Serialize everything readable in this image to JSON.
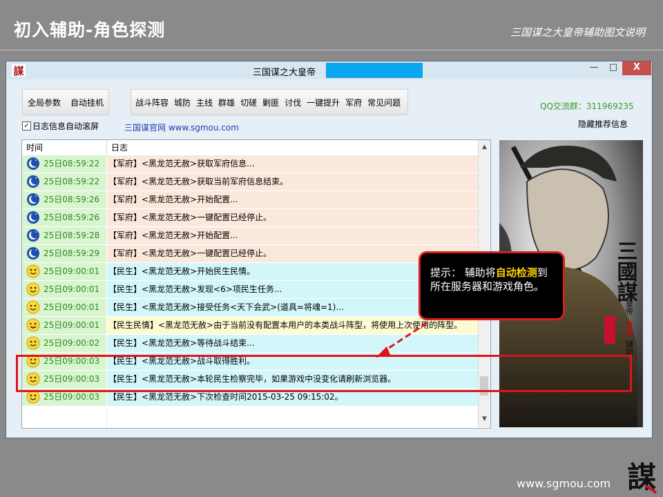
{
  "slide": {
    "title": "初入辅助-角色探测",
    "subtitle": "三国谋之大皇帝辅助图文说明",
    "footer_url": "www.sgmou.com",
    "logo_char": "謀"
  },
  "window": {
    "title": "三国谋之大皇帝",
    "icon_char": "謀",
    "controls": {
      "minimize": "—",
      "maximize": "□",
      "close": "X"
    }
  },
  "toolbar": {
    "group_a": [
      "全局参数",
      "自动挂机"
    ],
    "group_b": [
      "战斗阵容",
      "城防",
      "主线",
      "群雄",
      "切磋",
      "剿匪",
      "讨伐",
      "一键提升",
      "军府",
      "常见问题"
    ]
  },
  "qq_group": "QQ交流群：311969235",
  "options": {
    "auto_scroll_label": "日志信息自动滚屏",
    "auto_scroll_checked": true,
    "official_site": "三国谋官网 www.sgmou.com",
    "hide_recommend": "隐藏推荐信息"
  },
  "log": {
    "columns": {
      "time": "时间",
      "message": "日志"
    },
    "rows": [
      {
        "icon": "moon",
        "time": "25日08:59:22",
        "message": "【军府】<黑龙范无赦>获取军府信息...",
        "bg": "#fbe8dc"
      },
      {
        "icon": "moon",
        "time": "25日08:59:22",
        "message": "【军府】<黑龙范无赦>获取当前军府信息结束。",
        "bg": "#fbe8dc"
      },
      {
        "icon": "moon",
        "time": "25日08:59:26",
        "message": "【军府】<黑龙范无赦>开始配置...",
        "bg": "#fbe8dc"
      },
      {
        "icon": "moon",
        "time": "25日08:59:26",
        "message": "【军府】<黑龙范无赦>一键配置已经停止。",
        "bg": "#fbe8dc"
      },
      {
        "icon": "moon",
        "time": "25日08:59:28",
        "message": "【军府】<黑龙范无赦>开始配置...",
        "bg": "#fbe8dc"
      },
      {
        "icon": "moon",
        "time": "25日08:59:29",
        "message": "【军府】<黑龙范无赦>一键配置已经停止。",
        "bg": "#fbe8dc"
      },
      {
        "icon": "smile",
        "time": "25日09:00:01",
        "message": "【民生】<黑龙范无赦>开始民生民情。",
        "bg": "#d2f6fa"
      },
      {
        "icon": "smile",
        "time": "25日09:00:01",
        "message": "【民生】<黑龙范无赦>发现<6>项民生任务...",
        "bg": "#d2f6fa"
      },
      {
        "icon": "smile",
        "time": "25日09:00:01",
        "message": "【民生】<黑龙范无赦>接受任务<天下会武>(道具=将魂=1)...",
        "bg": "#d2f6fa"
      },
      {
        "icon": "wink",
        "time": "25日09:00:01",
        "message": "【民生民情】<黑龙范无赦>由于当前没有配置本用户的本类战斗阵型，将使用上次使用的阵型。",
        "bg": "#fdfbd2"
      },
      {
        "icon": "smile",
        "time": "25日09:00:02",
        "message": "【民生】<黑龙范无赦>等待战斗结束...",
        "bg": "#d2f6fa"
      },
      {
        "icon": "smile",
        "time": "25日09:00:03",
        "message": "【民生】<黑龙范无赦>战斗取得胜利。",
        "bg": "#d2f6fa"
      },
      {
        "icon": "smile",
        "time": "25日09:00:03",
        "message": "【民生】<黑龙范无赦>本轮民生检察完毕，如果游戏中没变化请刷新浏览器。",
        "bg": "#d2f6fa"
      },
      {
        "icon": "smile",
        "time": "25日09:00:03",
        "message": "【民生】<黑龙范无赦>下次检查时间2015-03-25 09:15:02。",
        "bg": "#d2f6fa"
      }
    ]
  },
  "poster": {
    "brand_chars": "三國謀",
    "side_text": "大皇帝",
    "accent_text": "首选",
    "side_text_2": "辅助"
  },
  "callout": {
    "prefix": "提示：  辅助将",
    "highlight": "自动检测",
    "suffix": "到所在服务器和游戏角色。"
  },
  "colors": {
    "slide_bg": "#8a8a8a",
    "window_bg": "#e6eef6",
    "title_redaction": "#0aa6f0",
    "qq_green": "#3aa02a",
    "time_green": "#2a8a1a",
    "time_cell_bg": "#d8f5d0",
    "row_junfu": "#fbe8dc",
    "row_minsheng": "#d2f6fa",
    "row_warning": "#fdfbd2",
    "highlight_red": "#e0131a",
    "callout_accent": "#ffd200"
  }
}
